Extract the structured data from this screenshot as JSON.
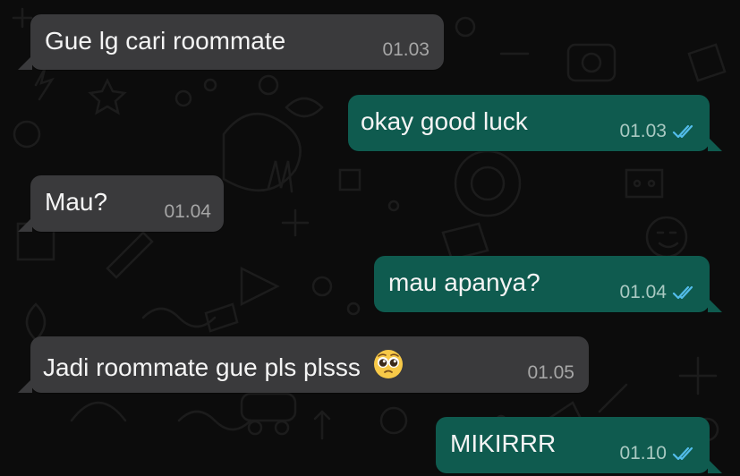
{
  "messages": [
    {
      "direction": "incoming",
      "text": "Gue lg cari roommate",
      "time": "01.03"
    },
    {
      "direction": "outgoing",
      "text": "okay good luck",
      "time": "01.03",
      "status_icon": "double-check-read-icon"
    },
    {
      "direction": "incoming",
      "text": "Mau?",
      "time": "01.04"
    },
    {
      "direction": "outgoing",
      "text": "mau apanya?",
      "time": "01.04",
      "status_icon": "double-check-read-icon"
    },
    {
      "direction": "incoming",
      "text": "Jadi roommate gue pls plsss",
      "time": "01.05",
      "emoji_icon": "pleading-face-emoji"
    },
    {
      "direction": "outgoing",
      "text": "MIKIRRR",
      "time": "01.10",
      "status_icon": "double-check-read-icon"
    }
  ],
  "colors": {
    "background": "#0c0c0c",
    "incoming_bubble": "#3a3a3c",
    "outgoing_bubble": "#0f5b4f",
    "read_ticks": "#53bdeb"
  }
}
